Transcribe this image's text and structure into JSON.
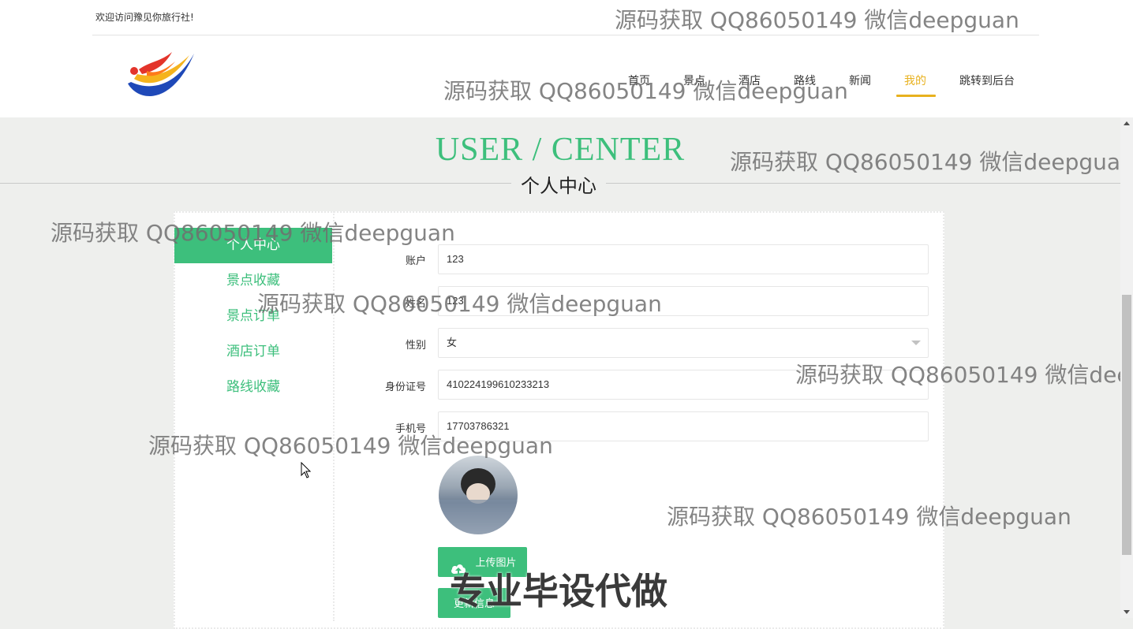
{
  "header": {
    "welcome": "欢迎访问豫见你旅行社!",
    "nav": [
      "首页",
      "景点",
      "酒店",
      "路线",
      "新闻",
      "我的",
      "跳转到后台"
    ],
    "active_nav": "我的"
  },
  "banner": {
    "title": "USER / CENTER",
    "subtitle": "个人中心"
  },
  "sidebar": {
    "items": [
      "个人中心",
      "景点收藏",
      "景点订单",
      "酒店订单",
      "路线收藏"
    ]
  },
  "form": {
    "account_label": "账户",
    "account_value": "123",
    "name_label": "姓名",
    "name_value": "123",
    "gender_label": "性别",
    "gender_value": "女",
    "id_label": "身份证号",
    "id_value": "410224199610233213",
    "phone_label": "手机号",
    "phone_value": "17703786321",
    "upload_label": "上传图片",
    "update_label": "更新信息"
  },
  "watermark": {
    "text": "源码获取 QQ86050149 微信deepguan",
    "promo": "专业毕设代做"
  },
  "colors": {
    "accent": "#3dbf7c",
    "nav_active": "#e8b11e"
  }
}
